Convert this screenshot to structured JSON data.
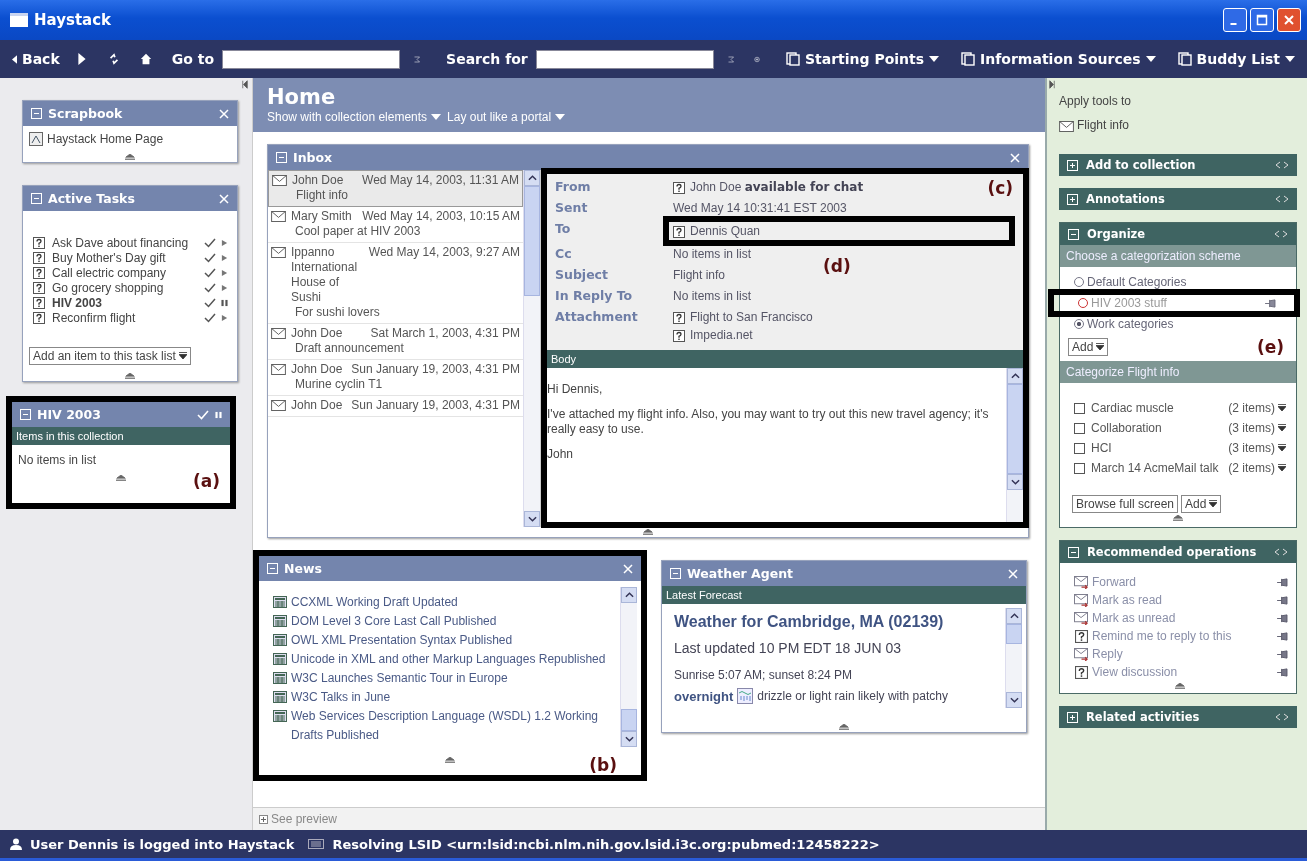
{
  "window": {
    "title": "Haystack"
  },
  "toolbar": {
    "back": "Back",
    "goto_label": "Go to",
    "search_label": "Search for",
    "menus": [
      "Starting Points",
      "Information Sources",
      "Buddy List"
    ]
  },
  "scrapbook": {
    "title": "Scrapbook",
    "items": [
      "Haystack Home Page"
    ]
  },
  "active_tasks": {
    "title": "Active Tasks",
    "add_field": "Add an item to this task list",
    "tasks": [
      {
        "label": "Ask Dave about financing",
        "current": false,
        "paused": false
      },
      {
        "label": "Buy Mother's Day gift",
        "current": false,
        "paused": false
      },
      {
        "label": "Call electric company",
        "current": false,
        "paused": false
      },
      {
        "label": "Go grocery shopping",
        "current": false,
        "paused": false
      },
      {
        "label": "HIV 2003",
        "current": true,
        "paused": true
      },
      {
        "label": "Reconfirm flight",
        "current": false,
        "paused": false
      }
    ]
  },
  "collection_pane": {
    "title": "HIV 2003",
    "paused": true,
    "subheader": "Items in this collection",
    "empty": "No items in list",
    "callout": "(a)"
  },
  "home": {
    "title": "Home",
    "options": [
      "Show with collection elements",
      "Lay out like a portal"
    ]
  },
  "inbox": {
    "title": "Inbox",
    "messages": [
      {
        "sender": "John Doe",
        "date": "Wed May 14, 2003, 11:31 AM",
        "subject": "Flight info",
        "selected": true
      },
      {
        "sender": "Mary Smith",
        "date": "Wed May 14, 2003, 10:15 AM",
        "subject": "Cool paper at HIV 2003",
        "selected": false
      },
      {
        "sender": "Ippanno International House of Sushi",
        "date": "Wed May 14, 2003, 9:27 AM",
        "subject": "For sushi lovers",
        "selected": false
      },
      {
        "sender": "John Doe",
        "date": "Sat March 1, 2003, 4:31 PM",
        "subject": "Draft announcement",
        "selected": false
      },
      {
        "sender": "John Doe",
        "date": "Sun January 19, 2003, 4:31 PM",
        "subject": "Murine cyclin T1",
        "selected": false
      },
      {
        "sender": "John Doe",
        "date": "Sun January 19, 2003, 4:31 PM",
        "selected": false
      }
    ],
    "detail_callout": "(c)",
    "fields": [
      {
        "label": "From",
        "values": [
          {
            "text": "John Doe **available for chat**",
            "icon": true
          }
        ]
      },
      {
        "label": "Sent",
        "values": [
          {
            "text": "Wed May 14 10:31:41 EST 2003",
            "icon": false
          }
        ]
      },
      {
        "label": "To",
        "values": [
          {
            "text": "Dennis Quan",
            "icon": true
          }
        ],
        "callout": "(d)"
      },
      {
        "label": "Cc",
        "values": [
          {
            "text": "No items in list",
            "icon": false
          }
        ]
      },
      {
        "label": "Subject",
        "values": [
          {
            "text": "Flight info",
            "icon": false
          }
        ]
      },
      {
        "label": "In Reply To",
        "values": [
          {
            "text": "No items in list",
            "icon": false
          }
        ]
      },
      {
        "label": "Attachment",
        "values": [
          {
            "text": "Flight to San Francisco",
            "icon": true
          },
          {
            "text": "Impedia.net",
            "icon": true
          }
        ]
      }
    ],
    "body_header": "Body",
    "body": [
      "Hi Dennis,",
      "I've attached my flight info. Also, you may want to try out this new travel agency; it's really easy to use.",
      "John"
    ]
  },
  "news": {
    "title": "News",
    "callout": "(b)",
    "items": [
      "CCXML Working Draft Updated",
      "DOM Level 3 Core Last Call Published",
      "OWL XML Presentation Syntax Published",
      "Unicode in XML and other Markup Languages Republished",
      "W3C Launches Semantic Tour in Europe",
      "W3C Talks in June",
      "Web Services Description Language (WSDL) 1.2 Working Drafts Published"
    ]
  },
  "weather": {
    "title": "Weather Agent",
    "subheader": "Latest Forecast",
    "heading": "Weather for Cambridge, MA (02139)",
    "updated": "Last updated 10 PM EDT 18 JUN 03",
    "sun": "Sunrise 5:07 AM; sunset 8:24 PM",
    "period": "overnight",
    "forecast": "drizzle or light rain likely with patchy"
  },
  "see_preview": "See preview",
  "tools": {
    "apply_label": "Apply tools to",
    "target": "Flight info",
    "sections": [
      {
        "title": "Add to collection",
        "expanded": false
      },
      {
        "title": "Annotations",
        "expanded": false
      },
      {
        "title": "Organize",
        "expanded": true,
        "kind": "organize"
      },
      {
        "title": "Recommended operations",
        "expanded": true,
        "kind": "operations"
      },
      {
        "title": "Related activities",
        "expanded": false
      }
    ]
  },
  "organize": {
    "scheme_header": "Choose a categorization scheme",
    "callout": "(e)",
    "schemes": [
      {
        "label": "Default Categories",
        "selected": false,
        "highlighted": false
      },
      {
        "label": "HIV 2003 stuff",
        "selected": false,
        "highlighted": true
      },
      {
        "label": "Work categories",
        "selected": true,
        "highlighted": false
      }
    ],
    "add": "Add",
    "categorize_header": "Categorize Flight info",
    "categories": [
      {
        "label": "Cardiac muscle",
        "count": "(2 items)",
        "checked": false
      },
      {
        "label": "Collaboration",
        "count": "(3 items)",
        "checked": false
      },
      {
        "label": "HCI",
        "count": "(3 items)",
        "checked": false
      },
      {
        "label": "March 14 AcmeMail talk",
        "count": "(2 items)",
        "checked": false
      }
    ],
    "buttons": [
      "Browse full screen",
      "Add"
    ]
  },
  "operations": [
    {
      "label": "Forward",
      "kind": "mail"
    },
    {
      "label": "Mark as read",
      "kind": "mail"
    },
    {
      "label": "Mark as unread",
      "kind": "mail"
    },
    {
      "label": "Remind me to reply to this",
      "kind": "unknown"
    },
    {
      "label": "Reply",
      "kind": "mail"
    },
    {
      "label": "View discussion",
      "kind": "unknown"
    }
  ],
  "status": {
    "user": "User Dennis is logged into Haystack",
    "activity": "Resolving LSID <urn:lsid:ncbi.nlm.nih.gov.lsid.i3c.org:pubmed:12458222>"
  }
}
